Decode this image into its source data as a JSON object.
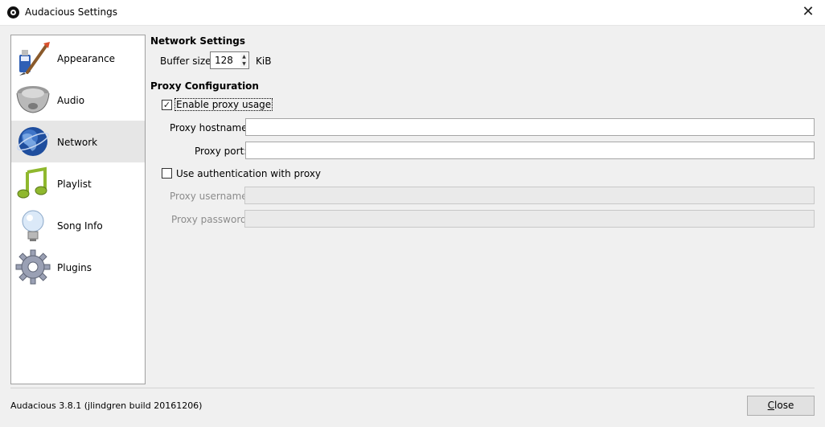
{
  "window": {
    "title": "Audacious Settings",
    "close_glyph": "✕"
  },
  "sidebar": {
    "items": [
      {
        "label": "Appearance",
        "icon": "paintbrush-icon",
        "selected": false
      },
      {
        "label": "Audio",
        "icon": "speaker-icon",
        "selected": false
      },
      {
        "label": "Network",
        "icon": "globe-icon",
        "selected": true
      },
      {
        "label": "Playlist",
        "icon": "music-note-icon",
        "selected": false
      },
      {
        "label": "Song Info",
        "icon": "lightbulb-icon",
        "selected": false
      },
      {
        "label": "Plugins",
        "icon": "gear-icon",
        "selected": false
      }
    ]
  },
  "network": {
    "section_title": "Network Settings",
    "buffer_label": "Buffer size:",
    "buffer_value": "128",
    "buffer_unit": "KiB"
  },
  "proxy": {
    "section_title": "Proxy Configuration",
    "enable_label": "Enable proxy usage",
    "enable_checked": true,
    "hostname_label": "Proxy hostname:",
    "hostname_value": "",
    "port_label": "Proxy port:",
    "port_value": "",
    "auth_label": "Use authentication with proxy",
    "auth_checked": false,
    "username_label": "Proxy username:",
    "username_value": "",
    "password_label": "Proxy password:",
    "password_value": ""
  },
  "footer": {
    "version": "Audacious 3.8.1 (jlindgren build 20161206)",
    "close_label": "Close"
  },
  "colors": {
    "window_bg": "#f0f0f0",
    "selected_item_bg": "#e6e6e6",
    "disabled_text": "#8c8c8c"
  }
}
